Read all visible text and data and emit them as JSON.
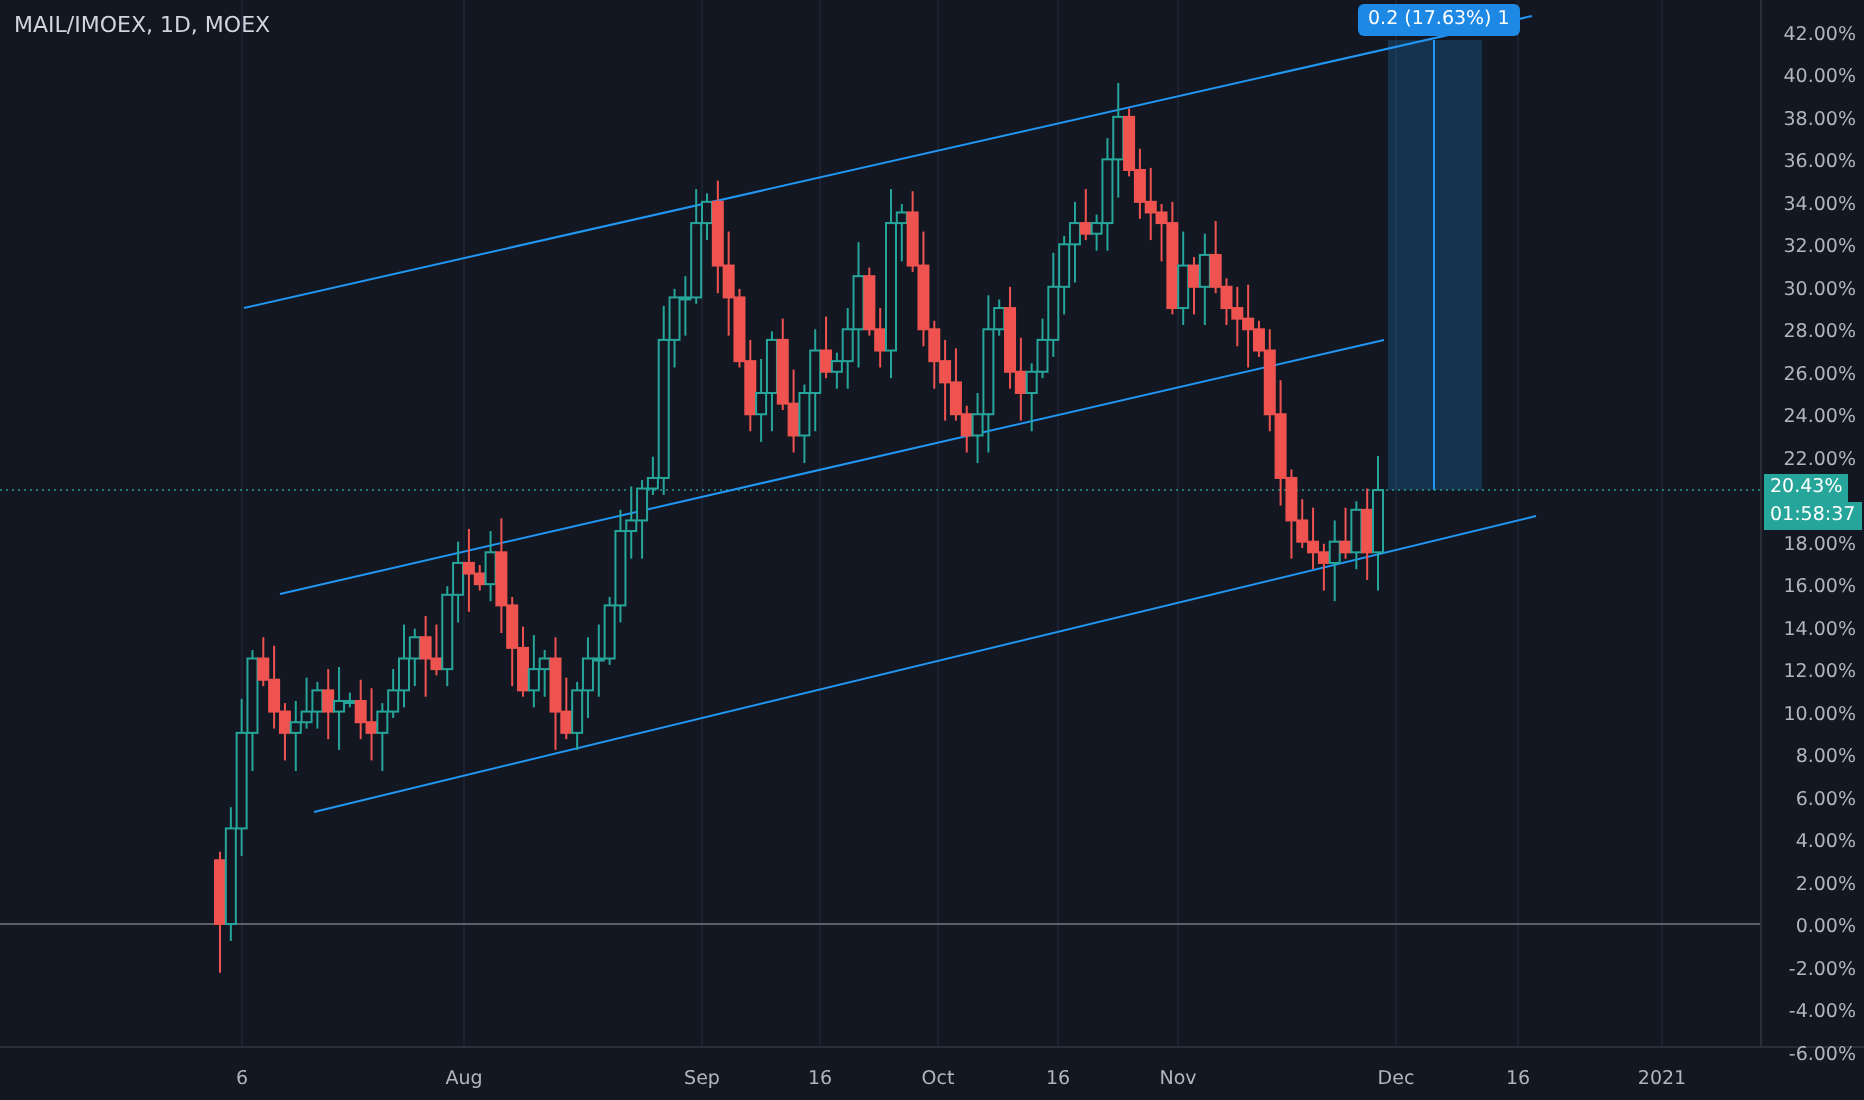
{
  "chart_title": "MAIL/IMOEX, 1D, MOEX",
  "measure_label": "0.2 (17.63%) 1",
  "price_axis": {
    "ticks_above": [
      "42.00%",
      "40.00%",
      "38.00%",
      "36.00%",
      "34.00%",
      "32.00%",
      "30.00%",
      "28.00%",
      "26.00%",
      "24.00%",
      "22.00%"
    ],
    "ticks_below": [
      "18.00%",
      "16.00%",
      "14.00%",
      "12.00%",
      "10.00%",
      "8.00%",
      "6.00%",
      "4.00%",
      "2.00%",
      "0.00%",
      "-2.00%",
      "-4.00%",
      "-6.00%"
    ],
    "current_value": "20.43%",
    "countdown": "01:58:37"
  },
  "time_axis": {
    "labels": [
      "6",
      "Aug",
      "Sep",
      "16",
      "Oct",
      "16",
      "Nov",
      "Dec",
      "16",
      "2021"
    ]
  }
}
